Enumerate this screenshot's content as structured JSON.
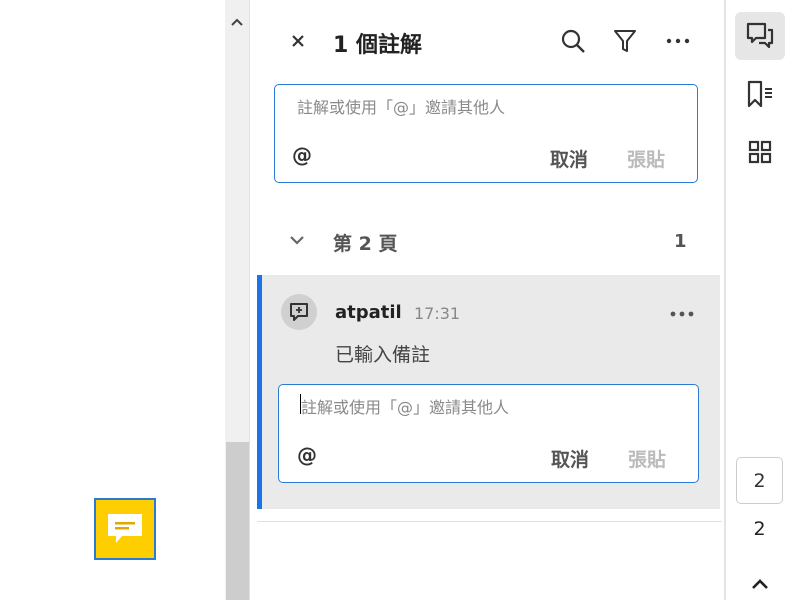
{
  "header": {
    "title": "1 個註解",
    "close_icon": "close-icon",
    "search_icon": "search-icon",
    "filter_icon": "filter-icon",
    "more_icon": "more-icon"
  },
  "new_comment": {
    "placeholder": "註解或使用「@」邀請其他人",
    "mention": "@",
    "cancel": "取消",
    "paste": "張貼"
  },
  "group": {
    "label": "第 2 頁",
    "count": "1"
  },
  "comment": {
    "author": "atpatil",
    "time": "17:31",
    "text": "已輸入備註"
  },
  "reply": {
    "placeholder": "註解或使用「@」邀請其他人",
    "mention": "@",
    "cancel": "取消",
    "paste": "張貼"
  },
  "rail": {
    "page_input": "2",
    "page_total": "2"
  },
  "colors": {
    "accent": "#1a73e8",
    "note": "#ffce00"
  }
}
